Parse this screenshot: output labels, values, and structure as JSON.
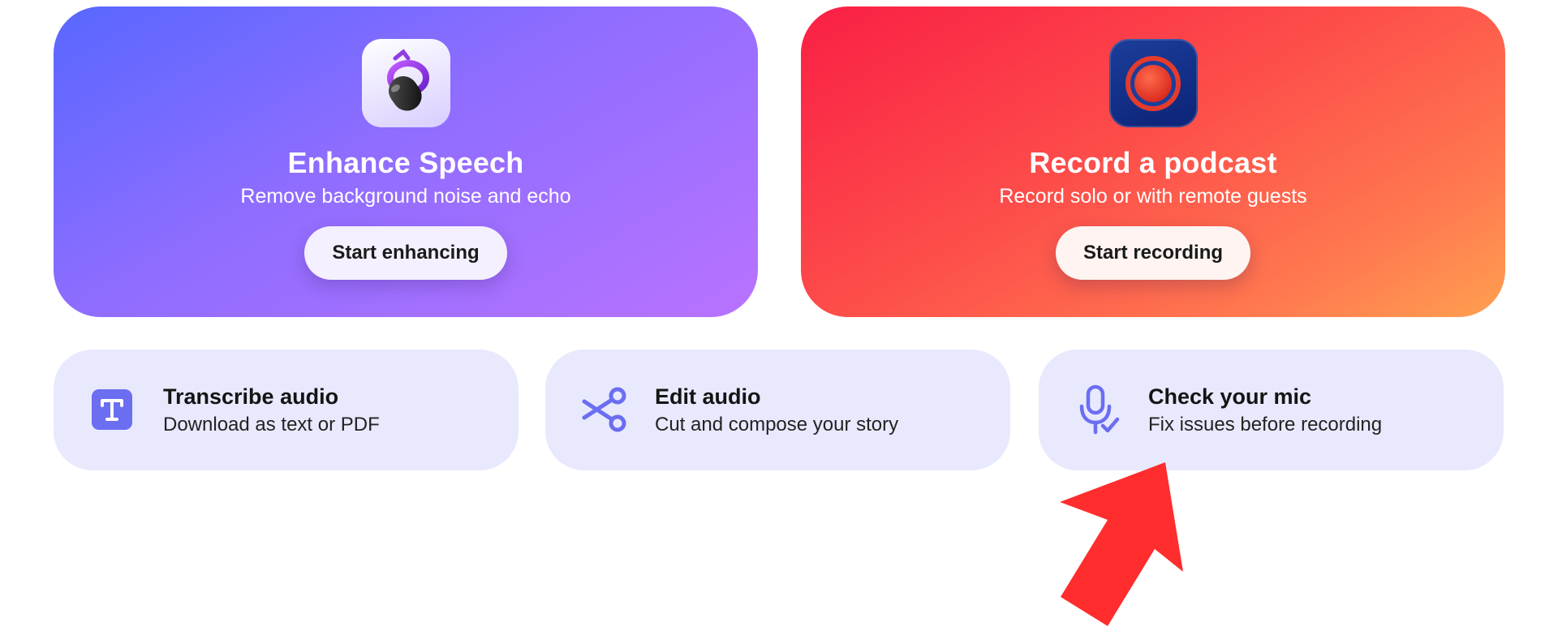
{
  "hero_cards": [
    {
      "icon": "microphone-app-icon",
      "title": "Enhance Speech",
      "subtitle": "Remove background noise and echo",
      "button_label": "Start enhancing"
    },
    {
      "icon": "record-app-icon",
      "title": "Record a podcast",
      "subtitle": "Record solo or with remote guests",
      "button_label": "Start recording"
    }
  ],
  "tiles": [
    {
      "icon": "transcribe-icon",
      "title": "Transcribe audio",
      "subtitle": "Download as text or PDF"
    },
    {
      "icon": "scissors-icon",
      "title": "Edit audio",
      "subtitle": "Cut and compose your story"
    },
    {
      "icon": "mic-check-icon",
      "title": "Check your mic",
      "subtitle": "Fix issues before recording"
    }
  ],
  "colors": {
    "accent": "#6b6ef0",
    "tile_background": "#e8e9fd",
    "annotation_arrow": "#ff2d2d"
  }
}
